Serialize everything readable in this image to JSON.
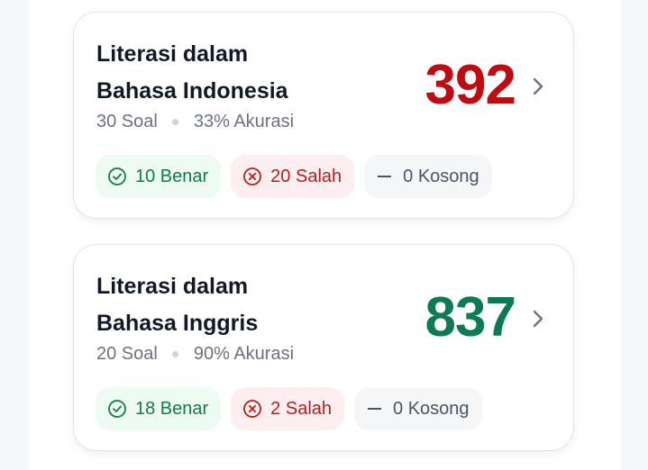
{
  "results": [
    {
      "title_line1": "Literasi dalam",
      "title_line2": "Bahasa Indonesia",
      "questions": "30 Soal",
      "accuracy": "33% Akurasi",
      "score": "392",
      "score_color": "#bd0d12",
      "correct": "10 Benar",
      "wrong": "20 Salah",
      "empty": "0 Kosong"
    },
    {
      "title_line1": "Literasi dalam",
      "title_line2": "Bahasa Inggris",
      "questions": "20 Soal",
      "accuracy": "90% Akurasi",
      "score": "837",
      "score_color": "#0c7a52",
      "correct": "18 Benar",
      "wrong": "2 Salah",
      "empty": "0 Kosong"
    }
  ],
  "icons": {
    "correct": "check-circle-icon",
    "wrong": "x-circle-icon",
    "empty": "dash-icon",
    "open": "chevron-right-icon"
  },
  "colors": {
    "correct": "#0f7a52",
    "wrong": "#b91c1c",
    "empty": "#4b5563"
  }
}
